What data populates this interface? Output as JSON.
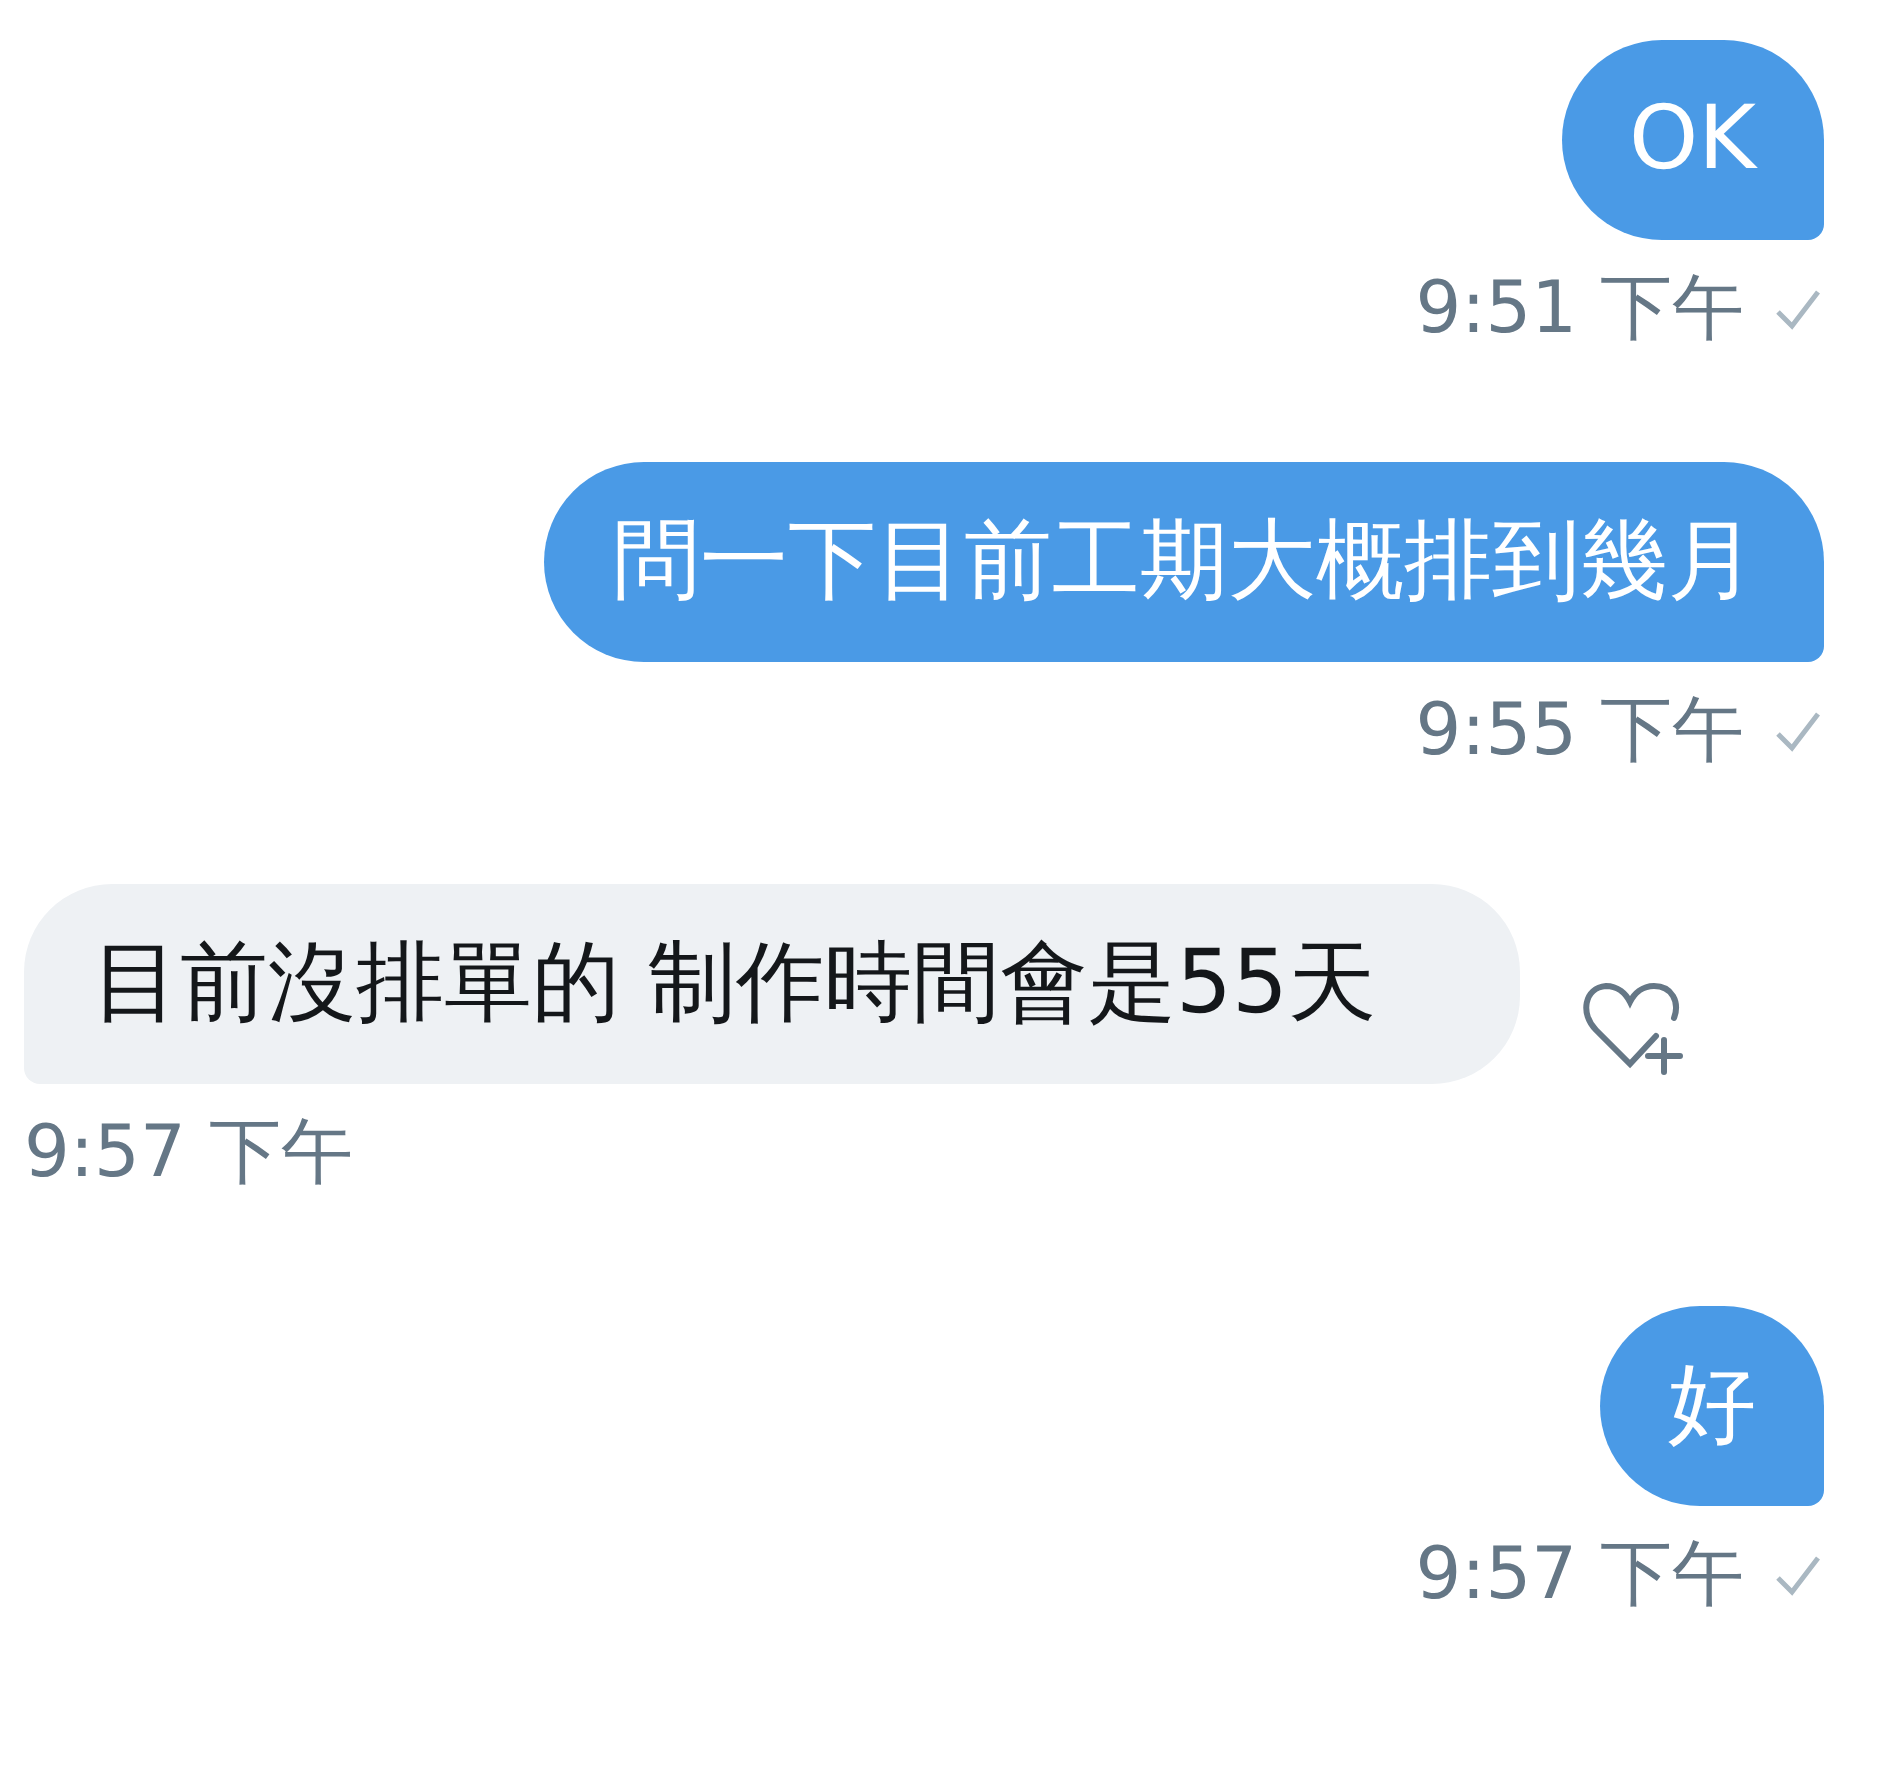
{
  "messages": [
    {
      "kind": "outgoing",
      "text": "OK",
      "time": "9:51 下午",
      "delivered": true
    },
    {
      "kind": "outgoing",
      "text": "問一下目前工期大概排到幾月",
      "time": "9:55 下午",
      "delivered": true
    },
    {
      "kind": "incoming",
      "text": "目前沒排單的 制作時間會是55天",
      "time": "9:57 下午"
    },
    {
      "kind": "outgoing",
      "text": "好",
      "time": "9:57 下午",
      "delivered": true
    }
  ]
}
